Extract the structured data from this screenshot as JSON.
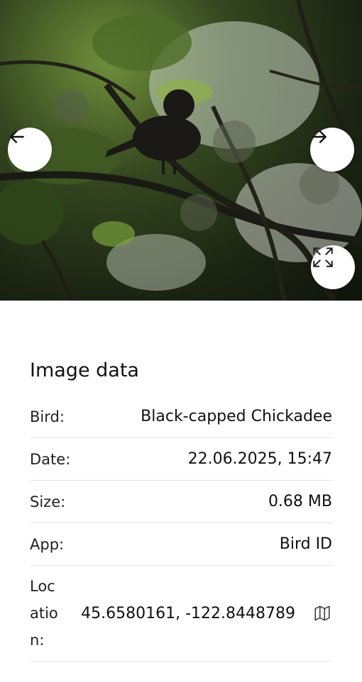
{
  "viewer": {
    "prev_icon": "arrow-left-icon",
    "next_icon": "arrow-right-icon",
    "expand_icon": "fullscreen-icon"
  },
  "info": {
    "title": "Image data",
    "rows": [
      {
        "label": "Bird:",
        "value": "Black-capped Chickadee"
      },
      {
        "label": "Date:",
        "value": "22.06.2025, 15:47"
      },
      {
        "label": "Size:",
        "value": "0.68 MB"
      },
      {
        "label": "App:",
        "value": "Bird ID"
      },
      {
        "label": "Location:",
        "value": "45.6580161, -122.8448789",
        "icon": "map-icon"
      }
    ]
  }
}
